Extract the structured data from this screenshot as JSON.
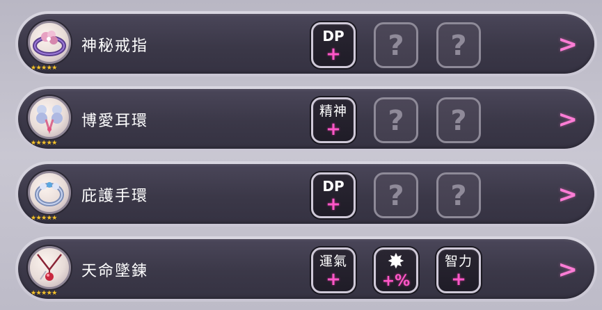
{
  "items": [
    {
      "name": "神秘戒指",
      "stars": "★★★★★",
      "icon": "ring-icon",
      "slots": [
        {
          "state": "known",
          "label": "DP",
          "symbol": "+"
        },
        {
          "state": "unknown",
          "symbol": "?"
        },
        {
          "state": "unknown",
          "symbol": "?"
        }
      ],
      "arrow": ">"
    },
    {
      "name": "博愛耳環",
      "stars": "★★★★★",
      "icon": "earring-icon",
      "slots": [
        {
          "state": "known",
          "label": "精神",
          "symbol": "+"
        },
        {
          "state": "unknown",
          "symbol": "?"
        },
        {
          "state": "unknown",
          "symbol": "?"
        }
      ],
      "arrow": ">"
    },
    {
      "name": "庇護手環",
      "stars": "★★★★★",
      "icon": "bracelet-icon",
      "slots": [
        {
          "state": "known",
          "label": "DP",
          "symbol": "+"
        },
        {
          "state": "unknown",
          "symbol": "?"
        },
        {
          "state": "unknown",
          "symbol": "?"
        }
      ],
      "arrow": ">"
    },
    {
      "name": "天命墜鍊",
      "stars": "★★★★★",
      "icon": "pendant-icon",
      "slots": [
        {
          "state": "known",
          "label": "運氣",
          "symbol": "+"
        },
        {
          "state": "known",
          "label": "✸",
          "symbol": "+%"
        },
        {
          "state": "known",
          "label": "智力",
          "symbol": "+"
        }
      ],
      "arrow": ">"
    }
  ],
  "colors": {
    "accent_pink": "#ff57c8",
    "arrow_pink": "#ff7dd6",
    "star_gold": "#f2c230"
  }
}
